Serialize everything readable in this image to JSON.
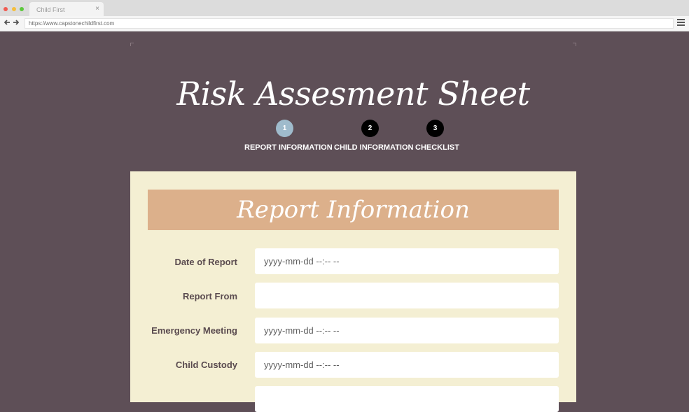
{
  "browser": {
    "tab_title": "Child First",
    "tab_close": "×",
    "url": "https://www.capstonechildfirst.com",
    "back_glyph": "🡐",
    "forward_glyph": "🡒"
  },
  "page": {
    "title": "Risk Assesment Sheet"
  },
  "steps": [
    {
      "number": "1",
      "label": "REPORT INFORMATION",
      "state": "active"
    },
    {
      "number": "2",
      "label": "CHILD INFORMATION",
      "state": "pending"
    },
    {
      "number": "3",
      "label": "CHECKLIST",
      "state": "pending"
    }
  ],
  "form": {
    "section_title": "Report Information",
    "fields": [
      {
        "label": "Date of Report",
        "value": "yyyy-mm-dd --:-- --"
      },
      {
        "label": "Report From",
        "value": ""
      },
      {
        "label": "Emergency Meeting",
        "value": "yyyy-mm-dd --:-- --"
      },
      {
        "label": "Child Custody",
        "value": "yyyy-mm-dd --:-- --"
      }
    ]
  },
  "colors": {
    "background": "#5e4f57",
    "card": "#f4efd3",
    "section_header": "#dcb08b",
    "step_active": "#9fbbcc",
    "step_pending": "#000000"
  }
}
